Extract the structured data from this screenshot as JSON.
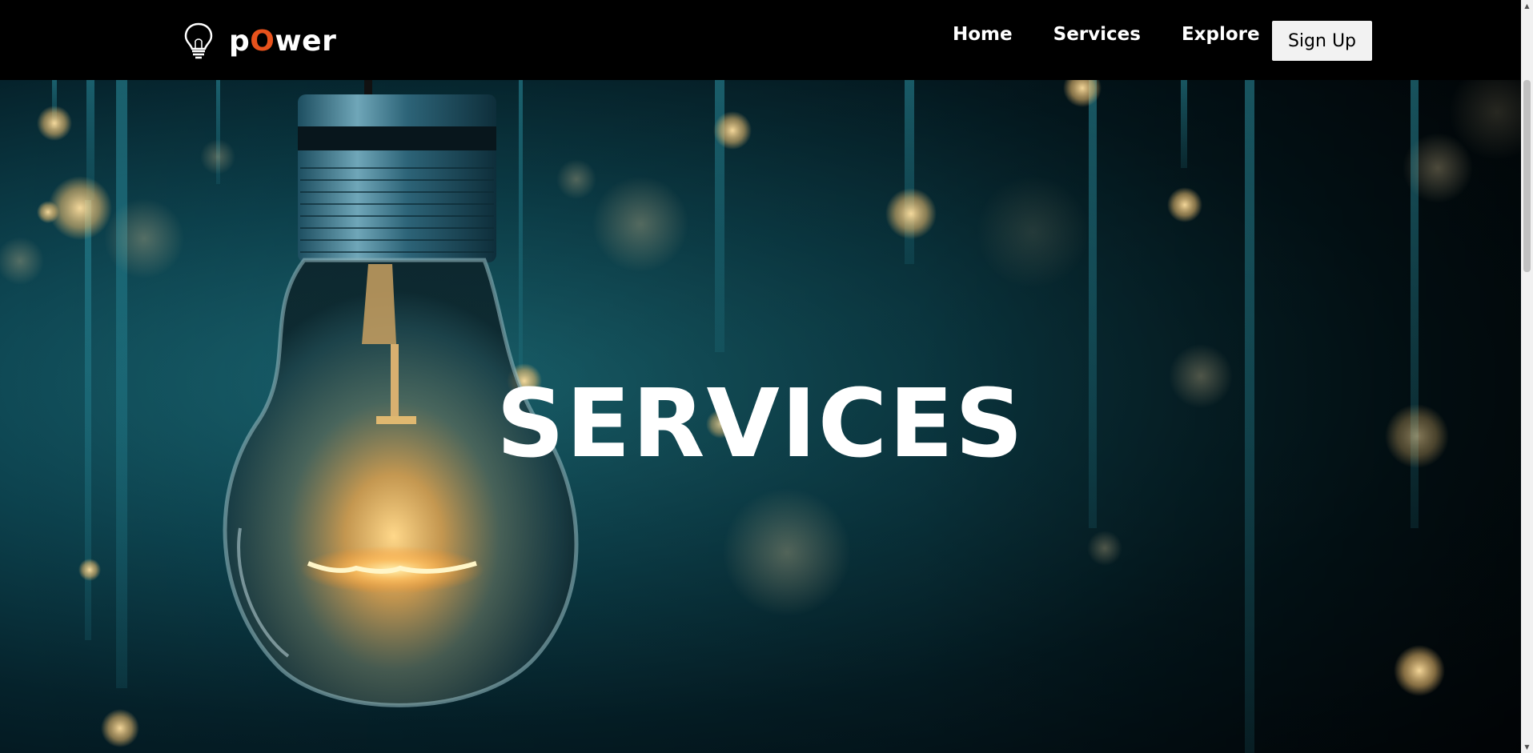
{
  "brand": {
    "icon": "lightbulb-icon",
    "name_prefix": "p",
    "name_accent": "O",
    "name_suffix": "wer",
    "accent_color": "#e8521c"
  },
  "nav": {
    "links": [
      "Home",
      "Services",
      "Explore"
    ],
    "signup_label": "Sign Up"
  },
  "hero": {
    "title": "SERVICES"
  },
  "scrollbar": {
    "up_icon": "arrow-up-icon",
    "down_icon": "arrow-down-icon"
  }
}
